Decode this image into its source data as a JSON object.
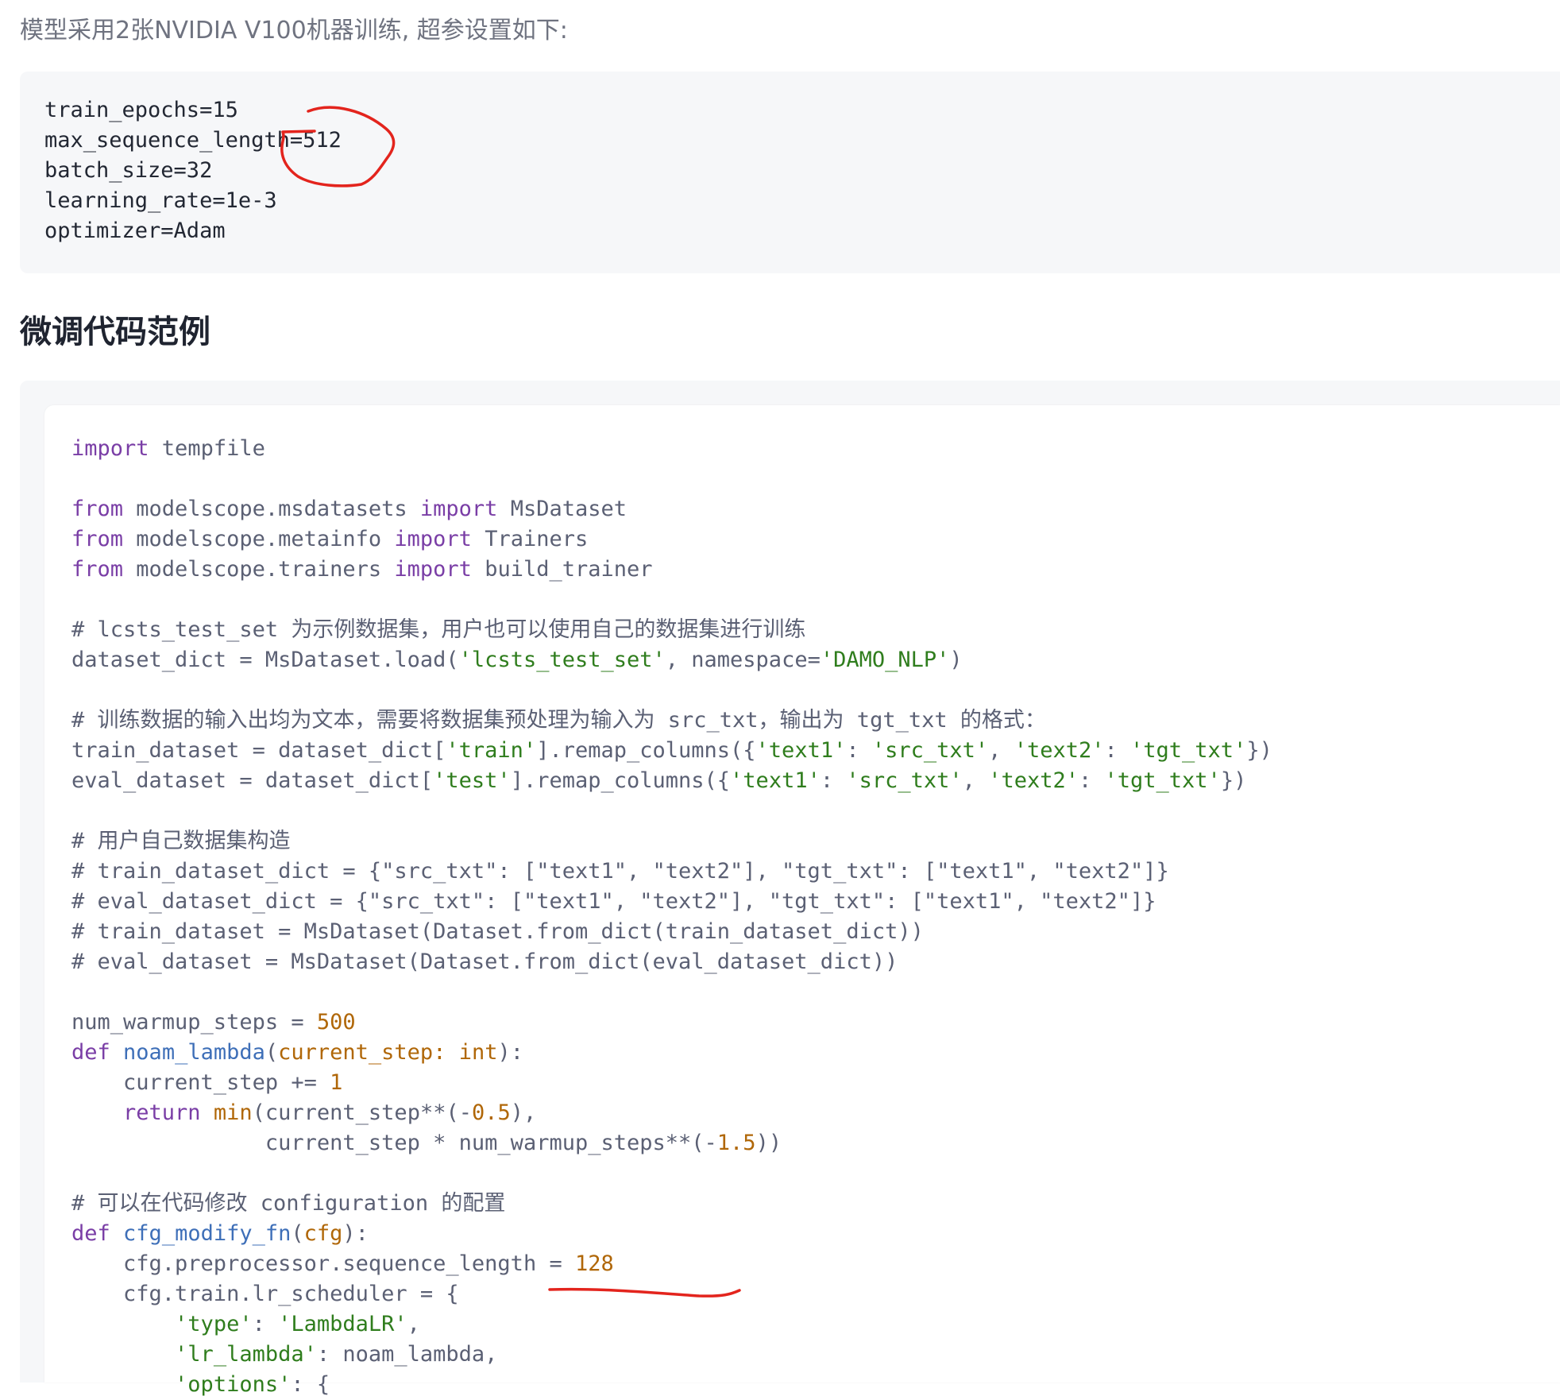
{
  "intro": "模型采用2张NVIDIA V100机器训练, 超参设置如下:",
  "hyperparams": [
    "train_epochs=15",
    "max_sequence_length=512",
    "batch_size=32",
    "learning_rate=1e-3",
    "optimizer=Adam"
  ],
  "section_title": "微调代码范例",
  "code_lines": [
    [
      {
        "t": "import",
        "c": "kw"
      },
      {
        "t": " tempfile",
        "c": "pl"
      }
    ],
    [],
    [
      {
        "t": "from",
        "c": "kw"
      },
      {
        "t": " modelscope.msdatasets ",
        "c": "pl"
      },
      {
        "t": "import",
        "c": "kw"
      },
      {
        "t": " MsDataset",
        "c": "pl"
      }
    ],
    [
      {
        "t": "from",
        "c": "kw"
      },
      {
        "t": " modelscope.metainfo ",
        "c": "pl"
      },
      {
        "t": "import",
        "c": "kw"
      },
      {
        "t": " Trainers",
        "c": "pl"
      }
    ],
    [
      {
        "t": "from",
        "c": "kw"
      },
      {
        "t": " modelscope.trainers ",
        "c": "pl"
      },
      {
        "t": "import",
        "c": "kw"
      },
      {
        "t": " build_trainer",
        "c": "pl"
      }
    ],
    [],
    [
      {
        "t": "# lcsts_test_set 为示例数据集，用户也可以使用自己的数据集进行训练",
        "c": "cm"
      }
    ],
    [
      {
        "t": "dataset_dict = MsDataset.load(",
        "c": "pl"
      },
      {
        "t": "'lcsts_test_set'",
        "c": "str"
      },
      {
        "t": ", namespace=",
        "c": "pl"
      },
      {
        "t": "'DAMO_NLP'",
        "c": "str"
      },
      {
        "t": ")",
        "c": "pl"
      }
    ],
    [],
    [
      {
        "t": "# 训练数据的输入出均为文本，需要将数据集预处理为输入为 src_txt，输出为 tgt_txt 的格式：",
        "c": "cm"
      }
    ],
    [
      {
        "t": "train_dataset = dataset_dict[",
        "c": "pl"
      },
      {
        "t": "'train'",
        "c": "str"
      },
      {
        "t": "].remap_columns({",
        "c": "pl"
      },
      {
        "t": "'text1'",
        "c": "str"
      },
      {
        "t": ": ",
        "c": "pl"
      },
      {
        "t": "'src_txt'",
        "c": "str"
      },
      {
        "t": ", ",
        "c": "pl"
      },
      {
        "t": "'text2'",
        "c": "str"
      },
      {
        "t": ": ",
        "c": "pl"
      },
      {
        "t": "'tgt_txt'",
        "c": "str"
      },
      {
        "t": "})",
        "c": "pl"
      }
    ],
    [
      {
        "t": "eval_dataset = dataset_dict[",
        "c": "pl"
      },
      {
        "t": "'test'",
        "c": "str"
      },
      {
        "t": "].remap_columns({",
        "c": "pl"
      },
      {
        "t": "'text1'",
        "c": "str"
      },
      {
        "t": ": ",
        "c": "pl"
      },
      {
        "t": "'src_txt'",
        "c": "str"
      },
      {
        "t": ", ",
        "c": "pl"
      },
      {
        "t": "'text2'",
        "c": "str"
      },
      {
        "t": ": ",
        "c": "pl"
      },
      {
        "t": "'tgt_txt'",
        "c": "str"
      },
      {
        "t": "})",
        "c": "pl"
      }
    ],
    [],
    [
      {
        "t": "# 用户自己数据集构造",
        "c": "cm"
      }
    ],
    [
      {
        "t": "# train_dataset_dict = {\"src_txt\": [\"text1\", \"text2\"], \"tgt_txt\": [\"text1\", \"text2\"]}",
        "c": "cm"
      }
    ],
    [
      {
        "t": "# eval_dataset_dict = {\"src_txt\": [\"text1\", \"text2\"], \"tgt_txt\": [\"text1\", \"text2\"]}",
        "c": "cm"
      }
    ],
    [
      {
        "t": "# train_dataset = MsDataset(Dataset.from_dict(train_dataset_dict))",
        "c": "cm"
      }
    ],
    [
      {
        "t": "# eval_dataset = MsDataset(Dataset.from_dict(eval_dataset_dict))",
        "c": "cm"
      }
    ],
    [],
    [
      {
        "t": "num_warmup_steps = ",
        "c": "pl"
      },
      {
        "t": "500",
        "c": "num"
      }
    ],
    [
      {
        "t": "def",
        "c": "kw"
      },
      {
        "t": " ",
        "c": "pl"
      },
      {
        "t": "noam_lambda",
        "c": "fn"
      },
      {
        "t": "(",
        "c": "pl"
      },
      {
        "t": "current_step: int",
        "c": "num"
      },
      {
        "t": "):",
        "c": "pl"
      }
    ],
    [
      {
        "t": "    current_step += ",
        "c": "pl"
      },
      {
        "t": "1",
        "c": "num"
      }
    ],
    [
      {
        "t": "    ",
        "c": "pl"
      },
      {
        "t": "return",
        "c": "kw"
      },
      {
        "t": " ",
        "c": "pl"
      },
      {
        "t": "min",
        "c": "num"
      },
      {
        "t": "(current_step**(-",
        "c": "pl"
      },
      {
        "t": "0.5",
        "c": "num"
      },
      {
        "t": "),",
        "c": "pl"
      }
    ],
    [
      {
        "t": "               current_step * num_warmup_steps**(-",
        "c": "pl"
      },
      {
        "t": "1.5",
        "c": "num"
      },
      {
        "t": "))",
        "c": "pl"
      }
    ],
    [],
    [
      {
        "t": "# 可以在代码修改 configuration 的配置",
        "c": "cm"
      }
    ],
    [
      {
        "t": "def",
        "c": "kw"
      },
      {
        "t": " ",
        "c": "pl"
      },
      {
        "t": "cfg_modify_fn",
        "c": "fn"
      },
      {
        "t": "(",
        "c": "pl"
      },
      {
        "t": "cfg",
        "c": "num"
      },
      {
        "t": "):",
        "c": "pl"
      }
    ],
    [
      {
        "t": "    cfg.preprocessor.sequence_length = ",
        "c": "pl"
      },
      {
        "t": "128",
        "c": "num"
      }
    ],
    [
      {
        "t": "    cfg.train.lr_scheduler = {",
        "c": "pl"
      }
    ],
    [
      {
        "t": "        ",
        "c": "pl"
      },
      {
        "t": "'type'",
        "c": "str"
      },
      {
        "t": ": ",
        "c": "pl"
      },
      {
        "t": "'LambdaLR'",
        "c": "str"
      },
      {
        "t": ",",
        "c": "pl"
      }
    ],
    [
      {
        "t": "        ",
        "c": "pl"
      },
      {
        "t": "'lr_lambda'",
        "c": "str"
      },
      {
        "t": ": noam_lambda,",
        "c": "pl"
      }
    ],
    [
      {
        "t": "        ",
        "c": "pl"
      },
      {
        "t": "'options'",
        "c": "str"
      },
      {
        "t": ": {",
        "c": "pl"
      }
    ]
  ],
  "colors": {
    "keyword": "#7a3ea6",
    "string": "#2f7d1d",
    "number": "#b06708",
    "function": "#3e6fb8",
    "plain": "#5b6074",
    "annotation": "#e3241d"
  }
}
